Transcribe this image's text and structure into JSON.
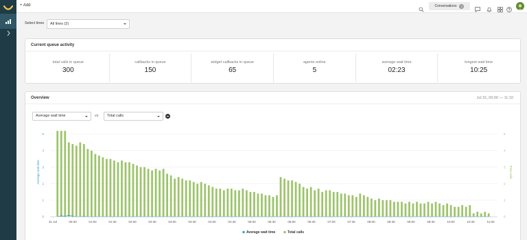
{
  "topbar": {
    "add_label": "+ Add",
    "conversations_label": "Conversations",
    "conversations_count": "0"
  },
  "icons": {
    "logo": "brand-logo-icon",
    "analytics": "bar-chart-icon",
    "connect": "transfer-icon",
    "search": "search-icon",
    "chat": "chat-icon",
    "notifications": "bell-icon",
    "apps": "grid-icon",
    "help": "help-icon",
    "avatar": "user-avatar-icon"
  },
  "filters": {
    "select_lines_label": "Select lines",
    "lines_value": "All lines (2)"
  },
  "queue": {
    "title": "Current queue activity",
    "metrics": [
      {
        "label": "total calls in queue",
        "value": "300"
      },
      {
        "label": "callbacks in queue",
        "value": "150"
      },
      {
        "label": "widget callbacks in queue",
        "value": "65"
      },
      {
        "label": "agents online",
        "value": "5"
      },
      {
        "label": "average wait time",
        "value": "02:23"
      },
      {
        "label": "longest wait time",
        "value": "10:25"
      }
    ]
  },
  "overview": {
    "title": "Overview",
    "range": "Jul 31, 00:00 — 11:10",
    "metric_a": "Average wait time",
    "vs": "vs",
    "metric_b": "Total calls"
  },
  "colors": {
    "rail": "#1f3b46",
    "bars": "#9cc46a",
    "line": "#3aa6c9"
  },
  "chart_data": {
    "type": "bar",
    "y_left_label": "Average wait time",
    "y_right_label": "Total calls",
    "y_left_ticks": [
      "0",
      "1",
      "2",
      "3",
      "4",
      "5"
    ],
    "y_right_ticks": [
      "0",
      "1",
      "2",
      "3",
      "4",
      "5"
    ],
    "ylim": [
      0,
      5.4
    ],
    "x_tick_labels": [
      "31 Jul",
      "00:30",
      "01:00",
      "01:30",
      "02:00",
      "02:30",
      "03:00",
      "03:30",
      "04:00",
      "04:30",
      "05:00",
      "05:30",
      "06:00",
      "06:30",
      "07:00",
      "07:30",
      "08:00",
      "08:30",
      "09:00",
      "09:30",
      "10:00",
      "10:30",
      "11:00"
    ],
    "legend": [
      {
        "name": "Average wait time",
        "color": "#3aa6c9"
      },
      {
        "name": "Total calls",
        "color": "#9cc46a"
      }
    ],
    "series": [
      {
        "name": "Total calls",
        "values": [
          5.2,
          5.2,
          5.2,
          4.5,
          4.4,
          4.3,
          4.5,
          4.4,
          4.1,
          4.0,
          3.8,
          3.7,
          3.6,
          3.5,
          3.5,
          3.4,
          3.3,
          3.4,
          3.3,
          3.3,
          3.2,
          3.1,
          3.0,
          3.0,
          2.9,
          2.8,
          2.9,
          2.8,
          2.9,
          2.6,
          2.5,
          2.3,
          2.4,
          2.3,
          2.2,
          2.2,
          2.1,
          2.0,
          2.1,
          2.0,
          1.9,
          1.8,
          1.7,
          1.7,
          1.6,
          1.7,
          1.7,
          1.6,
          1.6,
          1.7,
          1.6,
          1.5,
          1.5,
          1.4,
          1.4,
          1.3,
          1.3,
          1.2,
          1.3,
          2.4,
          2.3,
          2.2,
          2.2,
          2.1,
          2.0,
          1.8,
          1.7,
          1.8,
          1.6,
          1.7,
          1.5,
          1.6,
          1.6,
          1.5,
          1.5,
          1.4,
          1.4,
          1.3,
          1.3,
          1.2,
          1.4,
          1.3,
          1.2,
          1.1,
          1.0,
          1.1,
          1.0,
          1.0,
          1.0,
          0.9,
          0.9,
          0.9,
          0.8,
          0.9,
          0.8,
          0.9,
          0.8,
          0.8,
          0.9,
          0.8,
          0.9,
          0.8,
          0.7,
          0.8,
          0.7,
          0.6,
          0.6,
          0.7,
          0.6,
          0.7,
          0.2,
          0.3,
          0.2,
          0.3,
          0.2
        ]
      },
      {
        "name": "Average wait time",
        "values": [
          0,
          0.05,
          0.02,
          0.08,
          0.03,
          0,
          0,
          0.02,
          0,
          0,
          0,
          0,
          0,
          0,
          0,
          0,
          0,
          0,
          0,
          0,
          0,
          0,
          0,
          0,
          0,
          0,
          0,
          0,
          0,
          0,
          0,
          0,
          0,
          0,
          0,
          0,
          0,
          0,
          0,
          0,
          0,
          0,
          0,
          0,
          0,
          0,
          0,
          0,
          0,
          0,
          0,
          0,
          0,
          0,
          0,
          0,
          0,
          0,
          0,
          0,
          0,
          0,
          0,
          0,
          0,
          0,
          0,
          0,
          0,
          0,
          0,
          0,
          0,
          0,
          0,
          0,
          0,
          0,
          0,
          0,
          0,
          0,
          0,
          0,
          0,
          0,
          0,
          0,
          0,
          0,
          0,
          0,
          0,
          0,
          0,
          0,
          0,
          0,
          0,
          0,
          0,
          0,
          0,
          0,
          0,
          0,
          0,
          0,
          0,
          0,
          0,
          0,
          0,
          0,
          0
        ]
      }
    ],
    "grid": true,
    "legend_placement": "bottom-center"
  }
}
